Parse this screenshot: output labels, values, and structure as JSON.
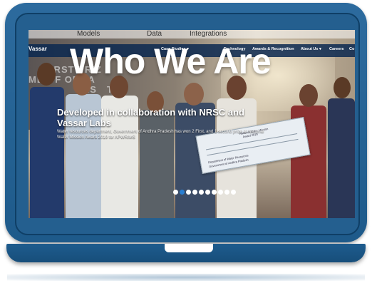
{
  "hero": {
    "title": "Who We Are"
  },
  "site": {
    "logo_text": "Vassar",
    "top_links": [
      "Models",
      "Data",
      "Integrations"
    ],
    "nav_items": [
      "Case Studies ▾",
      "Technology",
      "Awards & Recognition",
      "About Us ▾",
      "Careers",
      "Co"
    ]
  },
  "backdrop": {
    "line1": "FIRST PRIZ",
    "line2": "ME OF ORGA",
    "line3": "VIS",
    "line4": "TE"
  },
  "slide": {
    "title": "Developed in collaboration with NRSC and Vassar Labs",
    "body": "Water resources department, Government of Andhra Pradesh has won 2 First, and 1 second prize at National Water Mission Award 2019 for APWRIMS",
    "cheque_line1": "National Water Mission",
    "cheque_line2": "Award 2019",
    "cheque_line3": "Department of Water Resources",
    "cheque_line4": "Government of Andhra Pradesh"
  },
  "carousel": {
    "total_slides": 10,
    "active_index": 1
  },
  "colors": {
    "laptop_body": "#2d6b9e",
    "laptop_border": "#0f3f66",
    "navbar": "#0a2850",
    "active_dot": "#2a7fd1"
  }
}
